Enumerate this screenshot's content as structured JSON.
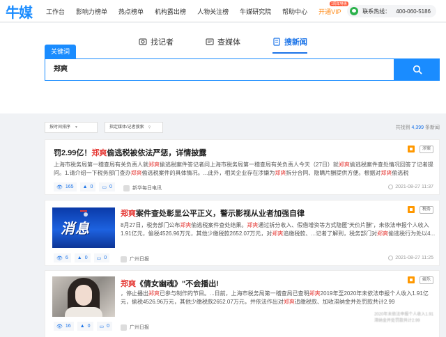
{
  "app": {
    "logo": "牛媒"
  },
  "nav": {
    "items": [
      "工作台",
      "影响力榜单",
      "热点榜单",
      "机构露出榜",
      "人物关注榜",
      "牛媒研究院",
      "帮助中心"
    ],
    "vip": "开通VIP",
    "vip_tag": "1周年特惠",
    "contact_label": "联系热线：",
    "contact_phone": "400-060-5186"
  },
  "tabs": [
    {
      "label": "找记者",
      "icon": "reporter-icon",
      "active": false
    },
    {
      "label": "查媒体",
      "icon": "media-icon",
      "active": false
    },
    {
      "label": "搜新闻",
      "icon": "news-icon",
      "active": true
    }
  ],
  "search": {
    "keyword_tag": "关键词",
    "value": "郑爽"
  },
  "filters": {
    "sort": "按时间排序",
    "media_search": "指定媒体/记者搜索",
    "found_prefix": "共找到",
    "found_count": "4,399",
    "found_suffix": "条新闻"
  },
  "results": [
    {
      "title_pre": "罚2.99亿！",
      "title_hl": "郑爽",
      "title_post": "偷逃税被依法严惩，详情披露",
      "tag": "涉案",
      "desc": [
        {
          "t": "上海市税务局第一稽查局有关负责人就",
          "h": false
        },
        {
          "t": "郑爽",
          "h": true
        },
        {
          "t": "偷逃税案件答记者问上海市税务局第一稽查局有关负责人今天（27日）就",
          "h": false
        },
        {
          "t": "郑爽",
          "h": true
        },
        {
          "t": "偷逃税案件查处情况回答了记者提问。1.请介绍一下税务部门查办",
          "h": false
        },
        {
          "t": "郑爽",
          "h": true
        },
        {
          "t": "偷逃税案件的具体情况。...此外，相关企业存在涉嫌为",
          "h": false
        },
        {
          "t": "郑爽",
          "h": true
        },
        {
          "t": "拆分合同、隐瞒片酬提供方便。根据对",
          "h": false
        },
        {
          "t": "郑爽",
          "h": true
        },
        {
          "t": "偷逃税",
          "h": false
        }
      ],
      "views": "165",
      "likes": "0",
      "comments": "0",
      "source": "新华每日电讯",
      "time": "2021-08-27 11:37"
    },
    {
      "title_hl": "郑爽",
      "title_post": "案件查处彰显公平正义，警示影视从业者加强自律",
      "tag": "税务",
      "thumb_text": "消息",
      "desc": [
        {
          "t": "8月27日，税务部门公布",
          "h": false
        },
        {
          "t": "郑爽",
          "h": true
        },
        {
          "t": "偷逃税案件查处结果。",
          "h": false
        },
        {
          "t": "郑爽",
          "h": true
        },
        {
          "t": "通过拆分收入、假借增资等方式隐匿“天价片酬”，未依法申报个人收入1.91亿元，偷税4526.96万元，其他少缴税款2652.07万元，对",
          "h": false
        },
        {
          "t": "郑爽",
          "h": true
        },
        {
          "t": "追缴税款、...记者了解到，税务部门对",
          "h": false
        },
        {
          "t": "郑爽",
          "h": true
        },
        {
          "t": "偷逃税行为处以4...",
          "h": false
        }
      ],
      "views": "6",
      "likes": "0",
      "comments": "0",
      "source": "广州日报",
      "time": "2021-08-27 11:25"
    },
    {
      "title_pre": "",
      "title_hl": "郑爽",
      "title_post": "《倩女幽魂》\"不会播出!",
      "tag": "娱乐",
      "desc": [
        {
          "t": "，停止播出",
          "h": false
        },
        {
          "t": "郑爽",
          "h": true
        },
        {
          "t": "已参与制作的节目。...日前，上海市税务局第一稽查局已查明",
          "h": false
        },
        {
          "t": "郑爽",
          "h": true
        },
        {
          "t": "2019年至2020年未依法申报个人收入1.91亿元，偷税4526.96万元，其他少缴税款2652.07万元，并依法作出对",
          "h": false
        },
        {
          "t": "郑爽",
          "h": true
        },
        {
          "t": "追缴税款、加收滞纳金并处罚款共计2.99",
          "h": false
        }
      ],
      "blur_lines": [
        "2020年未依法申报个人收入1.91",
        "滞纳金并处罚款共计2.99"
      ],
      "views": "16",
      "likes": "0",
      "comments": "0",
      "source": "广州日报"
    }
  ]
}
